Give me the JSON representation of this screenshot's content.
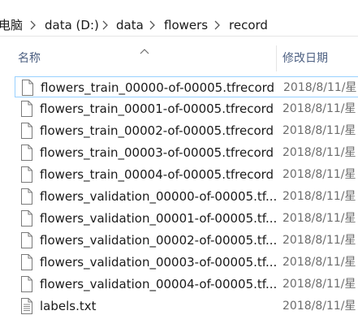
{
  "breadcrumb": {
    "items": [
      {
        "label": "电脑"
      },
      {
        "label": "data (D:)"
      },
      {
        "label": "data"
      },
      {
        "label": "flowers"
      },
      {
        "label": "record"
      }
    ]
  },
  "columns": {
    "name_label": "名称",
    "date_label": "修改日期"
  },
  "files": [
    {
      "name": "flowers_train_00000-of-00005.tfrecord",
      "date": "2018/8/11/星",
      "icon": "document-icon"
    },
    {
      "name": "flowers_train_00001-of-00005.tfrecord",
      "date": "2018/8/11/星",
      "icon": "document-icon"
    },
    {
      "name": "flowers_train_00002-of-00005.tfrecord",
      "date": "2018/8/11/星",
      "icon": "document-icon"
    },
    {
      "name": "flowers_train_00003-of-00005.tfrecord",
      "date": "2018/8/11/星",
      "icon": "document-icon"
    },
    {
      "name": "flowers_train_00004-of-00005.tfrecord",
      "date": "2018/8/11/星",
      "icon": "document-icon"
    },
    {
      "name": "flowers_validation_00000-of-00005.tf...",
      "date": "2018/8/11/星",
      "icon": "document-icon"
    },
    {
      "name": "flowers_validation_00001-of-00005.tf...",
      "date": "2018/8/11/星",
      "icon": "document-icon"
    },
    {
      "name": "flowers_validation_00002-of-00005.tf...",
      "date": "2018/8/11/星",
      "icon": "document-icon"
    },
    {
      "name": "flowers_validation_00003-of-00005.tf...",
      "date": "2018/8/11/星",
      "icon": "document-icon"
    },
    {
      "name": "flowers_validation_00004-of-00005.tf...",
      "date": "2018/8/11/星",
      "icon": "document-icon"
    },
    {
      "name": "labels.txt",
      "date": "2018/8/11/星",
      "icon": "text-file-icon"
    }
  ],
  "colors": {
    "header_text": "#4d6082",
    "focus_border": "#99d1ff",
    "date_text": "#6d6d6d"
  }
}
